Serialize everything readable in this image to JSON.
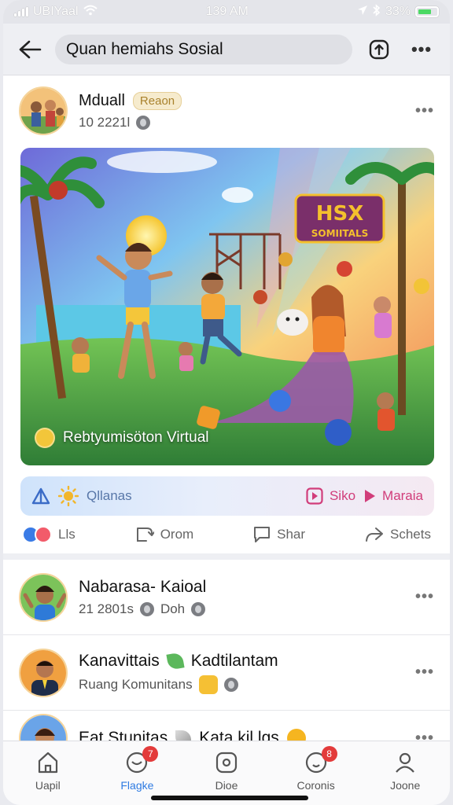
{
  "status_bar": {
    "carrier": "UBIYaal",
    "time": "139 AM",
    "battery": "33%"
  },
  "header": {
    "title": "Quan hemiahs Sosial",
    "back_icon": "arrow-left-icon",
    "share_icon": "upload-icon",
    "more_icon": "more-dots-icon"
  },
  "post": {
    "author": "Mduall",
    "badge": "Reaon",
    "time": "10 2221l",
    "image_banner": {
      "line1": "HSX",
      "line2": "SOMIITALS"
    },
    "image_caption": "Rebtyumisöton Virtual",
    "strip": {
      "left_label": "Qllanas",
      "right_item1": "Siko",
      "right_item2": "Maraia"
    },
    "actions": {
      "like": "Lls",
      "comment": "Orom",
      "share": "Shar",
      "send": "Schets"
    }
  },
  "list_posts": [
    {
      "author": "Nabarasa- Kaioal",
      "meta_time": "21 2801s",
      "meta_extra": "Doh"
    },
    {
      "author": "Kanavittais",
      "author_suffix": "Kadtilantam",
      "meta_extra": "Ruang Komunitans"
    },
    {
      "author": "Eat Stunitas",
      "author_suffix": "Kata kil lgs"
    }
  ],
  "tabs": [
    {
      "label": "Uapil",
      "icon": "home-icon",
      "active": false
    },
    {
      "label": "Flagke",
      "icon": "chat-bubble-icon",
      "active": true,
      "badge": "7"
    },
    {
      "label": "Dioe",
      "icon": "gamepad-icon",
      "active": false
    },
    {
      "label": "Coronis",
      "icon": "message-icon",
      "active": false,
      "badge": "8"
    },
    {
      "label": "Joone",
      "icon": "person-icon",
      "active": false
    }
  ],
  "colors": {
    "accent": "#2f7be2",
    "badge_red": "#e33b3b",
    "strip_pink": "#d13d7a"
  }
}
